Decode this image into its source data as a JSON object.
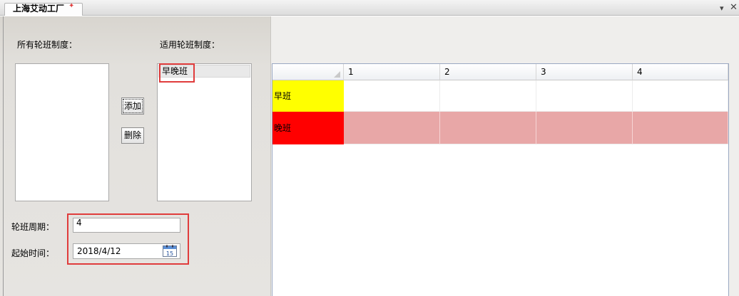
{
  "tab": {
    "title": "上海艾动工厂",
    "close_icon": "✦"
  },
  "window_controls": {
    "menu": "▾",
    "close": "✕"
  },
  "left": {
    "all_label": "所有轮班制度：",
    "apply_label": "适用轮班制度：",
    "apply_items": [
      "早晚班"
    ],
    "add_button": "添加",
    "delete_button": "删除",
    "period_label": "轮班周期：",
    "period_value": "4",
    "start_label": "起始时间：",
    "start_value": "2018/4/12",
    "calendar_day": "15"
  },
  "grid": {
    "columns": [
      "1",
      "2",
      "3",
      "4"
    ],
    "rows": [
      {
        "label": "早班",
        "color": "#ffff00"
      },
      {
        "label": "晚班",
        "color": "#ff0000"
      }
    ]
  },
  "colors": {
    "highlight_box": "#e03c3c",
    "evening_row_fill": "#e8a7a7"
  }
}
